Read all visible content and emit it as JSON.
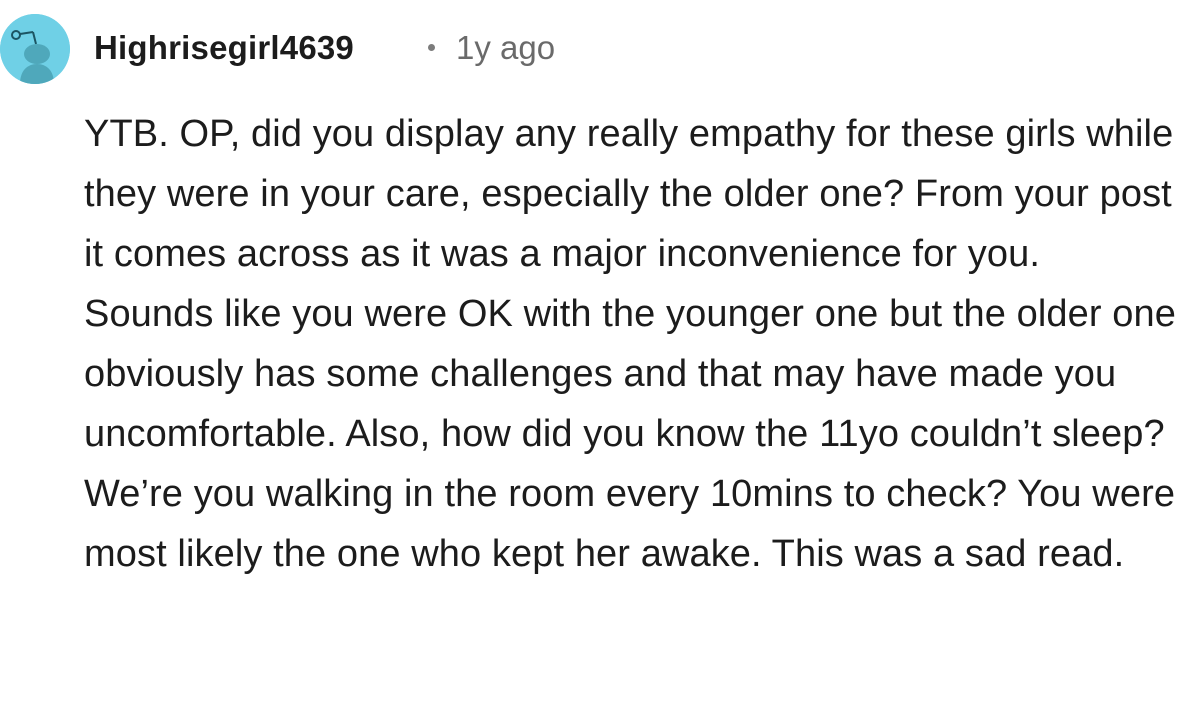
{
  "comment": {
    "author": "Highrisegirl4639",
    "separator": "·",
    "timestamp": "1y ago",
    "avatar": {
      "icon": "snoo-avatar-icon",
      "background_color": "#6fd0e6"
    },
    "body": "YTB. OP, did you display any really empathy for these girls while they were in your care, especially the older one? From your post it comes across as it was a major inconvenience for you. Sounds like you were OK with the younger one but the older one obviously has some challenges and that may have made you uncomfortable. Also, how did you know the 11yo couldn’t sleep? We’re you walking in the room every 10mins to check? You were most likely the one who kept her awake. This was a sad read."
  }
}
